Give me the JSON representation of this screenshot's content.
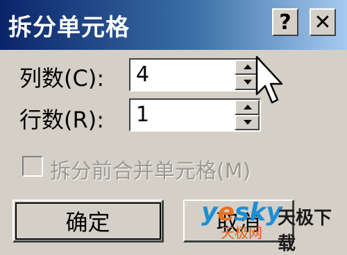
{
  "window": {
    "title": "拆分单元格"
  },
  "titlebar": {
    "help_label": "?",
    "close_label": "✕"
  },
  "fields": {
    "columns": {
      "label": "列数(C):",
      "value": "4"
    },
    "rows": {
      "label": "行数(R):",
      "value": "1"
    }
  },
  "checkbox": {
    "label": "拆分前合并单元格(M)",
    "checked": false,
    "disabled": true
  },
  "buttons": {
    "ok": "确定",
    "cancel": "取消"
  },
  "watermark": {
    "brand_y": "y",
    "brand_e": "e",
    "brand_rest": "sky",
    "cn": "天极下载",
    "sub": "天极网"
  },
  "colors": {
    "title_start": "#0a246a",
    "title_end": "#a6caf0",
    "face": "#d4d0c8"
  }
}
